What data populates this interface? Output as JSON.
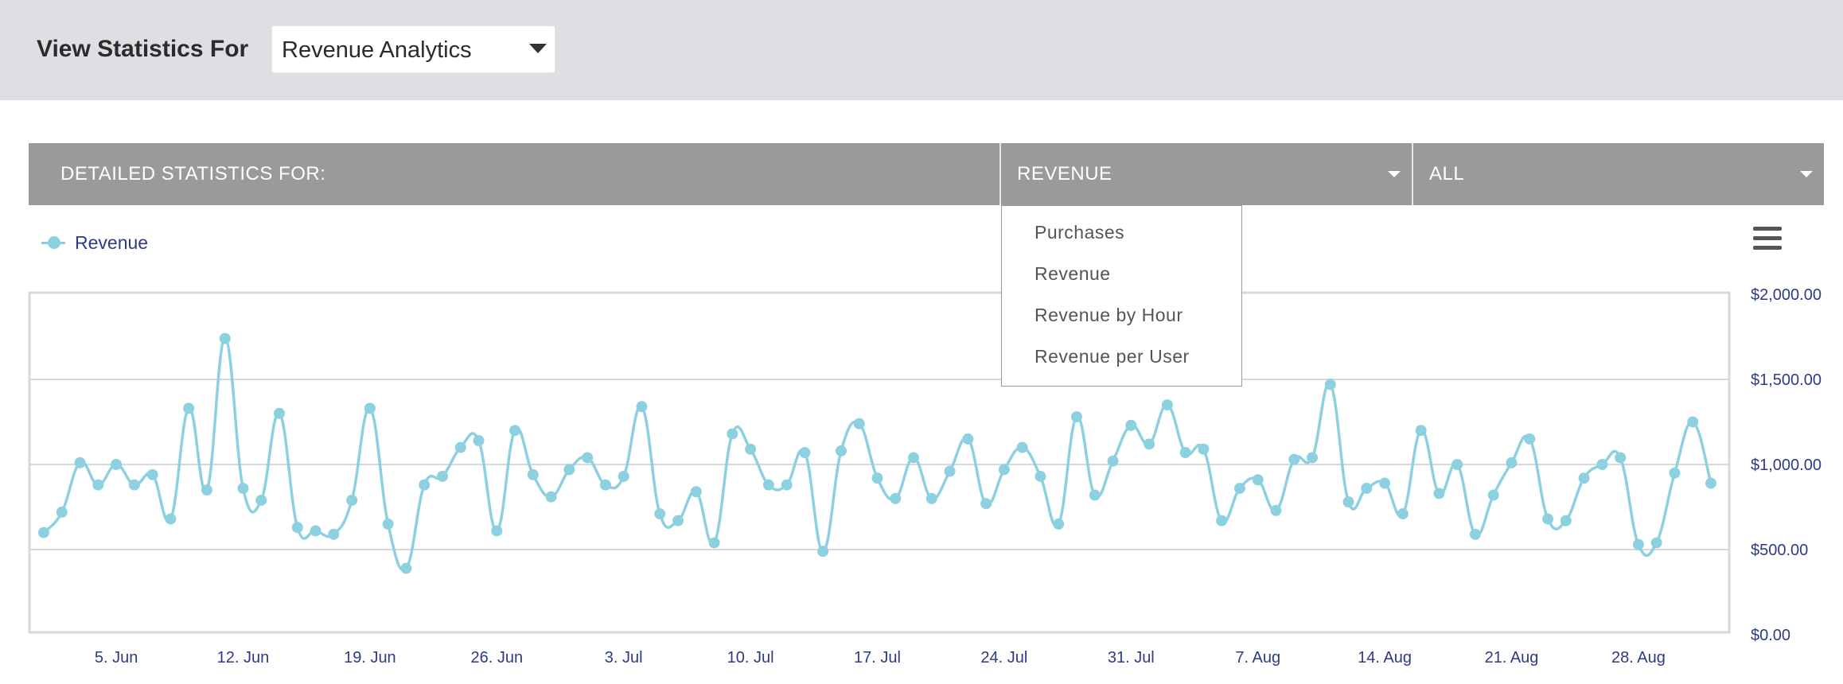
{
  "header": {
    "title": "View Statistics For",
    "select_value": "Revenue Analytics"
  },
  "detail_bar": {
    "label": "DETAILED STATISTICS FOR:",
    "metric_value": "REVENUE",
    "filter_value": "ALL"
  },
  "metric_menu": {
    "items": [
      "Purchases",
      "Revenue",
      "Revenue by Hour",
      "Revenue per User"
    ]
  },
  "colors": {
    "series": "#8dd1e1",
    "axis_text": "#2f3a86",
    "bar": "#9a9a9a",
    "topbar": "#dfdfe3"
  },
  "chart_data": {
    "type": "line",
    "legend_position": "top-left",
    "grid": true,
    "series": [
      {
        "name": "Revenue",
        "x": [
          "2023-06-01",
          "2023-06-02",
          "2023-06-03",
          "2023-06-04",
          "2023-06-05",
          "2023-06-06",
          "2023-06-07",
          "2023-06-08",
          "2023-06-09",
          "2023-06-10",
          "2023-06-11",
          "2023-06-12",
          "2023-06-13",
          "2023-06-14",
          "2023-06-15",
          "2023-06-16",
          "2023-06-17",
          "2023-06-18",
          "2023-06-19",
          "2023-06-20",
          "2023-06-21",
          "2023-06-22",
          "2023-06-23",
          "2023-06-24",
          "2023-06-25",
          "2023-06-26",
          "2023-06-27",
          "2023-06-28",
          "2023-06-29",
          "2023-06-30",
          "2023-07-01",
          "2023-07-02",
          "2023-07-03",
          "2023-07-04",
          "2023-07-05",
          "2023-07-06",
          "2023-07-07",
          "2023-07-08",
          "2023-07-09",
          "2023-07-10",
          "2023-07-11",
          "2023-07-12",
          "2023-07-13",
          "2023-07-14",
          "2023-07-15",
          "2023-07-16",
          "2023-07-17",
          "2023-07-18",
          "2023-07-19",
          "2023-07-20",
          "2023-07-21",
          "2023-07-22",
          "2023-07-23",
          "2023-07-24",
          "2023-07-25",
          "2023-07-26",
          "2023-07-27",
          "2023-07-28",
          "2023-07-29",
          "2023-07-30",
          "2023-07-31",
          "2023-08-01",
          "2023-08-02",
          "2023-08-03",
          "2023-08-04",
          "2023-08-05",
          "2023-08-06",
          "2023-08-07",
          "2023-08-08",
          "2023-08-09",
          "2023-08-10",
          "2023-08-11",
          "2023-08-12",
          "2023-08-13",
          "2023-08-14",
          "2023-08-15",
          "2023-08-16",
          "2023-08-17",
          "2023-08-18",
          "2023-08-19",
          "2023-08-20",
          "2023-08-21",
          "2023-08-22",
          "2023-08-23",
          "2023-08-24",
          "2023-08-25",
          "2023-08-26",
          "2023-08-27",
          "2023-08-28",
          "2023-08-29",
          "2023-08-30",
          "2023-08-31",
          "2023-09-01"
        ],
        "values": [
          600,
          720,
          1010,
          880,
          1000,
          880,
          940,
          680,
          1330,
          850,
          1740,
          860,
          790,
          1300,
          630,
          610,
          590,
          790,
          1330,
          650,
          390,
          880,
          930,
          1100,
          1140,
          610,
          1200,
          940,
          810,
          970,
          1040,
          880,
          930,
          1340,
          710,
          670,
          840,
          540,
          1180,
          1090,
          880,
          880,
          1070,
          490,
          1080,
          1240,
          920,
          800,
          1040,
          800,
          960,
          1150,
          770,
          970,
          1100,
          930,
          650,
          1280,
          820,
          1020,
          1230,
          1120,
          1350,
          1070,
          1090,
          670,
          860,
          910,
          730,
          1030,
          1040,
          1470,
          780,
          860,
          890,
          710,
          1200,
          830,
          1000,
          590,
          820,
          1010,
          1150,
          680,
          670,
          920,
          1000,
          1040,
          530,
          540,
          950,
          1250,
          890
        ]
      }
    ],
    "xticks": [
      "5. Jun",
      "12. Jun",
      "19. Jun",
      "26. Jun",
      "3. Jul",
      "10. Jul",
      "17. Jul",
      "24. Jul",
      "31. Jul",
      "7. Aug",
      "14. Aug",
      "21. Aug",
      "28. Aug"
    ],
    "yticks": [
      "$0.00",
      "$500.00",
      "$1,000.00",
      "$1,500.00",
      "$2,000.00"
    ],
    "ylim": [
      0,
      2000
    ]
  }
}
